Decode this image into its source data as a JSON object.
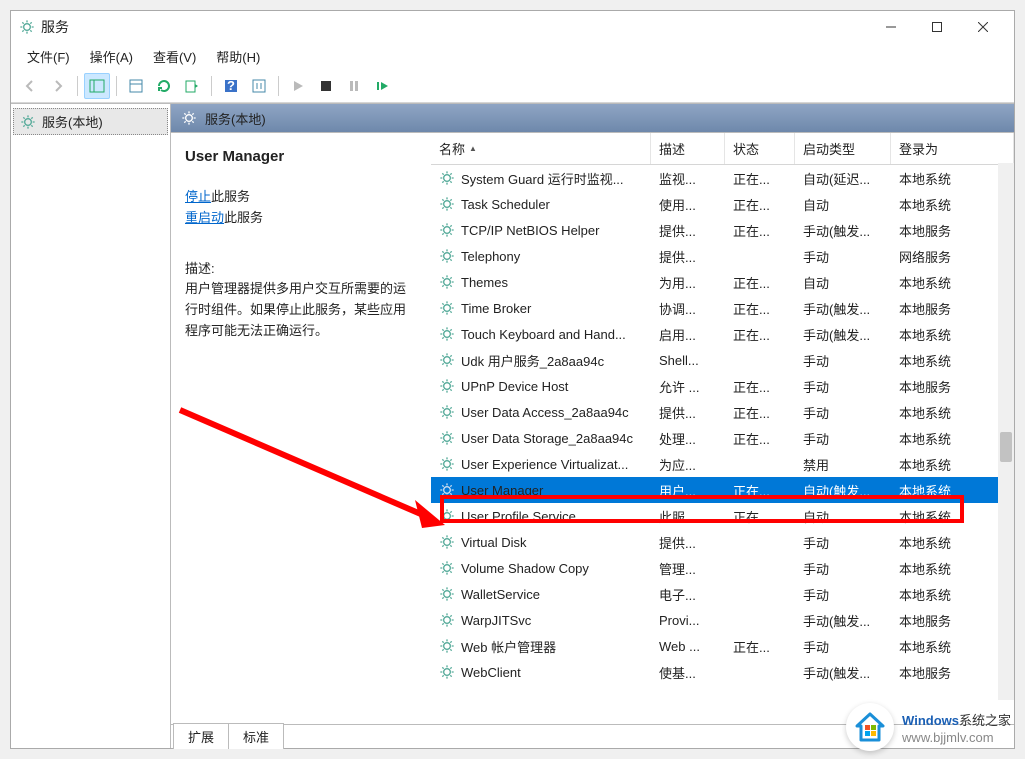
{
  "window": {
    "title": "服务"
  },
  "menubar": [
    {
      "id": "file",
      "label": "文件(F)"
    },
    {
      "id": "action",
      "label": "操作(A)"
    },
    {
      "id": "view",
      "label": "查看(V)"
    },
    {
      "id": "help",
      "label": "帮助(H)"
    }
  ],
  "tree": {
    "root_label": "服务(本地)"
  },
  "right_header": "服务(本地)",
  "detail": {
    "selected_name": "User Manager",
    "stop_link": "停止",
    "stop_suffix": "此服务",
    "restart_link": "重启动",
    "restart_suffix": "此服务",
    "desc_label": "描述:",
    "desc_text": "用户管理器提供多用户交互所需要的运行时组件。如果停止此服务，某些应用程序可能无法正确运行。"
  },
  "columns": {
    "name": "名称",
    "desc": "描述",
    "state": "状态",
    "start": "启动类型",
    "logon": "登录为"
  },
  "services": [
    {
      "name": "System Guard 运行时监视...",
      "desc": "监视...",
      "state": "正在...",
      "start": "自动(延迟...",
      "logon": "本地系统"
    },
    {
      "name": "Task Scheduler",
      "desc": "使用...",
      "state": "正在...",
      "start": "自动",
      "logon": "本地系统"
    },
    {
      "name": "TCP/IP NetBIOS Helper",
      "desc": "提供...",
      "state": "正在...",
      "start": "手动(触发...",
      "logon": "本地服务"
    },
    {
      "name": "Telephony",
      "desc": "提供...",
      "state": "",
      "start": "手动",
      "logon": "网络服务"
    },
    {
      "name": "Themes",
      "desc": "为用...",
      "state": "正在...",
      "start": "自动",
      "logon": "本地系统"
    },
    {
      "name": "Time Broker",
      "desc": "协调...",
      "state": "正在...",
      "start": "手动(触发...",
      "logon": "本地服务"
    },
    {
      "name": "Touch Keyboard and Hand...",
      "desc": "启用...",
      "state": "正在...",
      "start": "手动(触发...",
      "logon": "本地系统"
    },
    {
      "name": "Udk 用户服务_2a8aa94c",
      "desc": "Shell...",
      "state": "",
      "start": "手动",
      "logon": "本地系统"
    },
    {
      "name": "UPnP Device Host",
      "desc": "允许 ...",
      "state": "正在...",
      "start": "手动",
      "logon": "本地服务"
    },
    {
      "name": "User Data Access_2a8aa94c",
      "desc": "提供...",
      "state": "正在...",
      "start": "手动",
      "logon": "本地系统"
    },
    {
      "name": "User Data Storage_2a8aa94c",
      "desc": "处理...",
      "state": "正在...",
      "start": "手动",
      "logon": "本地系统"
    },
    {
      "name": "User Experience Virtualizat...",
      "desc": "为应...",
      "state": "",
      "start": "禁用",
      "logon": "本地系统"
    },
    {
      "name": "User Manager",
      "desc": "用户...",
      "state": "正在...",
      "start": "自动(触发...",
      "logon": "本地系统",
      "selected": true
    },
    {
      "name": "User Profile Service",
      "desc": "此服...",
      "state": "正在...",
      "start": "自动",
      "logon": "本地系统"
    },
    {
      "name": "Virtual Disk",
      "desc": "提供...",
      "state": "",
      "start": "手动",
      "logon": "本地系统"
    },
    {
      "name": "Volume Shadow Copy",
      "desc": "管理...",
      "state": "",
      "start": "手动",
      "logon": "本地系统"
    },
    {
      "name": "WalletService",
      "desc": "电子...",
      "state": "",
      "start": "手动",
      "logon": "本地系统"
    },
    {
      "name": "WarpJITSvc",
      "desc": "Provi...",
      "state": "",
      "start": "手动(触发...",
      "logon": "本地服务"
    },
    {
      "name": "Web 帐户管理器",
      "desc": "Web ...",
      "state": "正在...",
      "start": "手动",
      "logon": "本地系统"
    },
    {
      "name": "WebClient",
      "desc": "使基...",
      "state": "",
      "start": "手动(触发...",
      "logon": "本地服务"
    }
  ],
  "tabs": {
    "extended": "扩展",
    "standard": "标准"
  },
  "watermark": {
    "brand": "Windows",
    "suffix": "系统之家",
    "url": "www.bjjmlv.com"
  }
}
